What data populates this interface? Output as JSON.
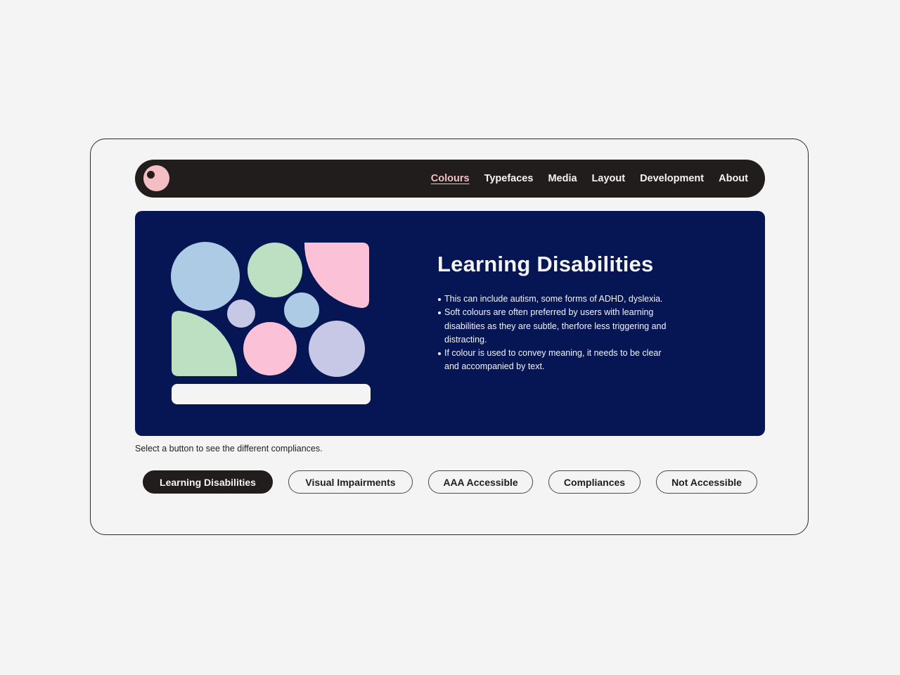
{
  "nav": {
    "logo": "eye-logo",
    "links": [
      {
        "label": "Colours",
        "active": true
      },
      {
        "label": "Typefaces",
        "active": false
      },
      {
        "label": "Media",
        "active": false
      },
      {
        "label": "Layout",
        "active": false
      },
      {
        "label": "Development",
        "active": false
      },
      {
        "label": "About",
        "active": false
      }
    ]
  },
  "hero": {
    "title": "Learning Disabilities",
    "bullets": [
      "This can include autism, some forms of ADHD, dyslexia.",
      "Soft colours are often preferred by users with learning disabilities as they are subtle, therfore less triggering and distracting.",
      "If colour is used to convey meaning, it needs to be clear and accompanied by text."
    ]
  },
  "hint": "Select a button to see the different compliances.",
  "buttons": [
    {
      "label": "Learning Disabilities",
      "active": true
    },
    {
      "label": "Visual Impairments",
      "active": false
    },
    {
      "label": "AAA Accessible",
      "active": false
    },
    {
      "label": "Compliances",
      "active": false
    },
    {
      "label": "Not Accessible",
      "active": false
    }
  ],
  "colors": {
    "page_background": "#f4f4f4",
    "navbar": "#201d1c",
    "accent_pink": "#f3bfc4",
    "hero_background": "#061654",
    "swatch_blue": "#aecbe6",
    "swatch_green": "#bde0c3",
    "swatch_pink": "#fbc1d6",
    "swatch_lavender": "#c7c8e6",
    "swatch_white": "#f4f4f4"
  }
}
